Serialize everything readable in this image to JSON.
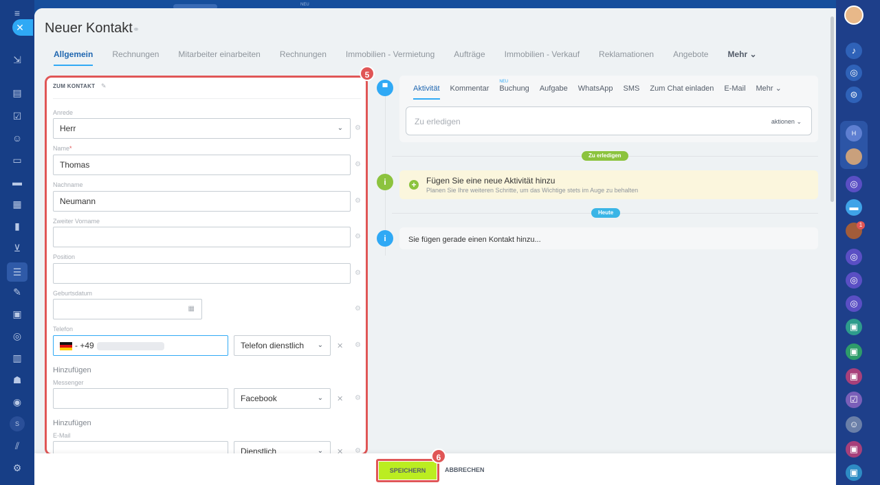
{
  "header": {
    "title": "Neuer Kontakt",
    "tabs": [
      "Allgemein",
      "Rechnungen",
      "Mitarbeiter einarbeiten",
      "Rechnungen",
      "Immobilien - Vermietung",
      "Aufträge",
      "Immobilien - Verkauf",
      "Reklamationen",
      "Angebote"
    ],
    "more_label": "Mehr"
  },
  "topbar": {
    "neu": "NEU"
  },
  "form": {
    "section_title": "ZUM KONTAKT",
    "badge": "5",
    "salutation_label": "Anrede",
    "salutation_value": "Herr",
    "name_label": "Name",
    "name_required": "*",
    "name_value": "Thomas",
    "lastname_label": "Nachname",
    "lastname_value": "Neumann",
    "middlename_label": "Zweiter Vorname",
    "middlename_value": "",
    "position_label": "Position",
    "position_value": "",
    "birthdate_label": "Geburtsdatum",
    "phone_label": "Telefon",
    "phone_prefix": "- +49",
    "phone_type": "Telefon dienstlich",
    "add_label": "Hinzufügen",
    "messenger_label": "Messenger",
    "messenger_type": "Facebook",
    "add_label_2": "Hinzufügen",
    "email_label": "E-Mail",
    "email_type": "Dienstlich"
  },
  "timeline": {
    "tabs": [
      "Aktivität",
      "Kommentar",
      "Buchung",
      "Aufgabe",
      "WhatsApp",
      "SMS",
      "Zum Chat einladen",
      "E-Mail"
    ],
    "more_label": "Mehr",
    "neu_tag": "NEU",
    "todo_placeholder": "Zu erledigen",
    "todo_actions": "aktionen",
    "pill_todo": "Zu erledigen",
    "activity_title": "Fügen Sie eine neue Aktivität hinzu",
    "activity_sub": "Planen Sie Ihre weiteren Schritte, um das Wichtige stets im Auge zu behalten",
    "pill_today": "Heute",
    "info_text": "Sie fügen gerade einen Kontakt hinzu..."
  },
  "footer": {
    "save_label": "SPEICHERN",
    "cancel_label": "ABBRECHEN",
    "badge": "6"
  },
  "rightbar": {
    "h_label": "H",
    "notif_count": "1"
  },
  "leftbar": {
    "s_label": "S"
  },
  "colors": {
    "accent_blue": "#2fa9f5",
    "highlight_red": "#e05656",
    "save_green": "#bbed21",
    "todo_pill": "#8cc33e"
  }
}
